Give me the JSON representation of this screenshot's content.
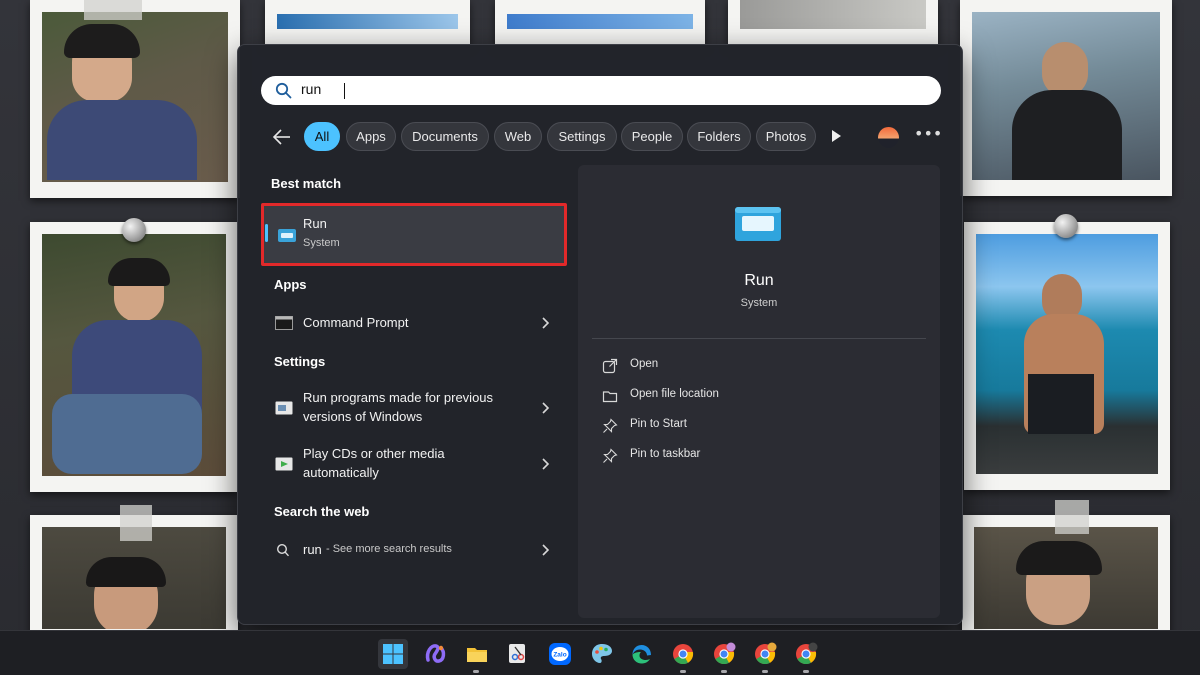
{
  "search": {
    "query": "run"
  },
  "filters": {
    "all": "All",
    "apps": "Apps",
    "documents": "Documents",
    "web": "Web",
    "settings": "Settings",
    "people": "People",
    "folders": "Folders",
    "photos": "Photos"
  },
  "results": {
    "best_match_header": "Best match",
    "best_match": {
      "title": "Run",
      "subtitle": "System"
    },
    "apps_header": "Apps",
    "apps": [
      {
        "title": "Command Prompt"
      }
    ],
    "settings_header": "Settings",
    "settings": [
      {
        "line1": "Run programs made for previous",
        "line2": "versions of Windows"
      },
      {
        "line1": "Play CDs or other media",
        "line2": "automatically"
      }
    ],
    "web_header": "Search the web",
    "web": {
      "query": "run",
      "suffix": " - See more search results"
    }
  },
  "preview": {
    "title": "Run",
    "subtitle": "System",
    "actions": [
      {
        "label": "Open",
        "icon": "open-external-icon"
      },
      {
        "label": "Open file location",
        "icon": "folder-icon"
      },
      {
        "label": "Pin to Start",
        "icon": "pin-icon"
      },
      {
        "label": "Pin to taskbar",
        "icon": "pin-icon"
      }
    ]
  },
  "taskbar": {
    "items": [
      "windows-start-icon",
      "copilot-icon",
      "file-explorer-icon",
      "snipping-tool-icon",
      "zalo-icon",
      "paint-icon",
      "edge-icon",
      "chrome-icon",
      "chrome-profile-icon",
      "chrome-profile-icon",
      "chrome-profile-icon"
    ],
    "zalo_label": "Zalo"
  },
  "colors": {
    "accent": "#4cc2ff",
    "highlight_border": "#e2292a",
    "panel": "#22242a"
  }
}
